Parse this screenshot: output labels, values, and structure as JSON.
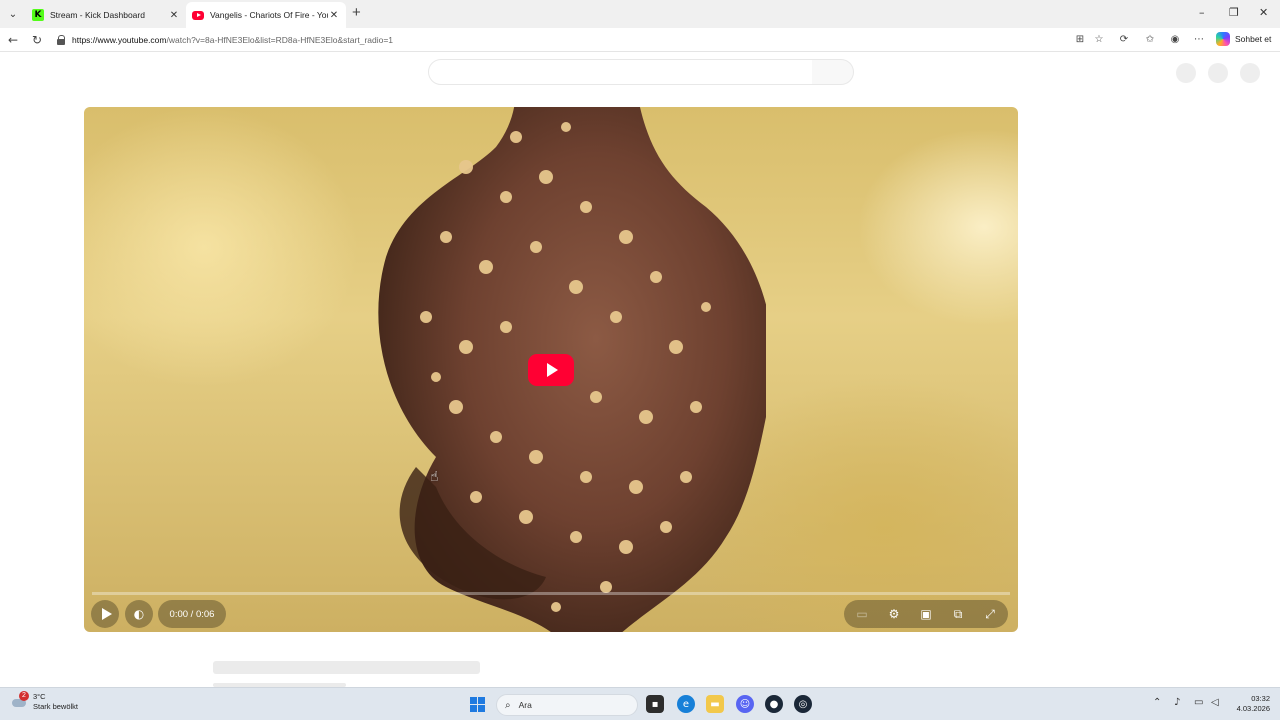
{
  "browser": {
    "tabs": [
      {
        "title": "Stream - Kick Dashboard",
        "favicon": "kick-icon",
        "active": false
      },
      {
        "title": "Vangelis - Chariots Of Fire - YouTube",
        "favicon": "youtube-icon",
        "active": true
      }
    ],
    "new_tab": "+",
    "url_host": "https://www.youtube.com",
    "url_rest": "/watch?v=8a-HfNE3Elo&list=RD8a-HfNE3Elo&start_radio=1",
    "copilot_label": "Sohbet et",
    "window_controls": {
      "minimize": "–",
      "restore": "❐",
      "close": "✕"
    }
  },
  "player": {
    "time": "0:00 / 0:06",
    "progress": 0,
    "state": "paused"
  },
  "taskbar": {
    "weather_temp": "3°C",
    "weather_desc": "Stark bewölkt",
    "weather_badge": "2",
    "search_placeholder": "Ara",
    "clock_time": "03:32",
    "clock_date": "4.03.2026"
  }
}
